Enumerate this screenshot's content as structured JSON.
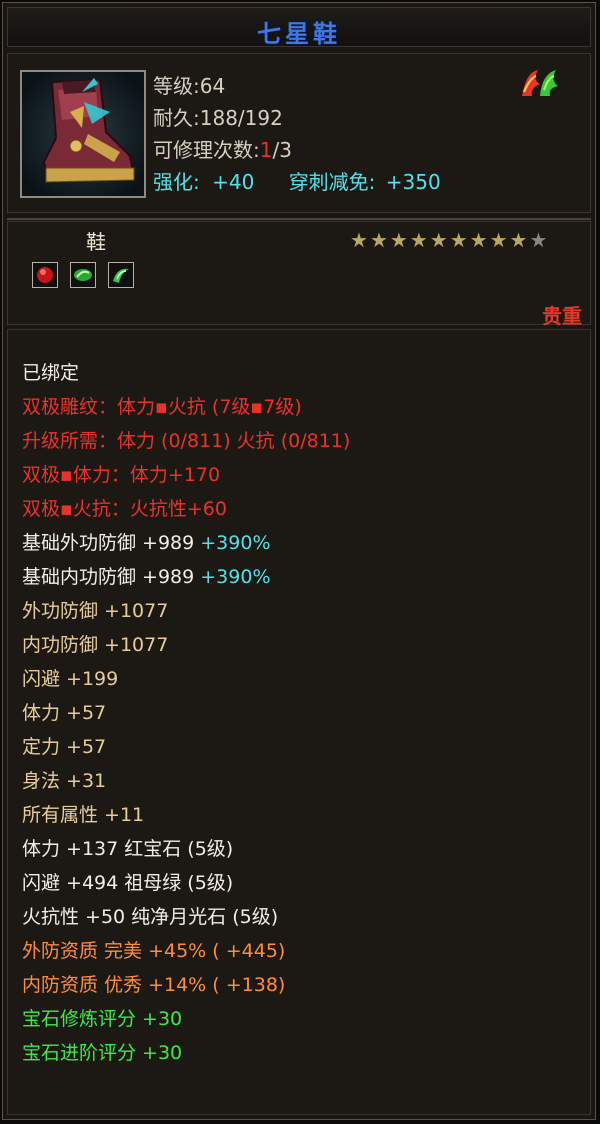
{
  "item": {
    "name": "七星鞋",
    "level_label": "等级:",
    "level": "64",
    "durability_label": "耐久:",
    "durability": "188/192",
    "repair_label": "可修理次数:",
    "repair_used": "1",
    "repair_total": "/3",
    "enhance_label": "强化:",
    "enhance_value": "+40",
    "pierce_label": "穿刺减免:",
    "pierce_value": "+350",
    "type": "鞋",
    "stars_filled": 9,
    "stars_total": 10,
    "rarity": "贵重",
    "icon": "boot-icon",
    "gem_icons": [
      "ruby-gem-icon",
      "emerald-gem-icon",
      "moonstone-gem-icon"
    ],
    "badge_icon": "dragon-badge-icon"
  },
  "stats": {
    "bound": "已绑定",
    "dual_pattern": "双极雕纹：体力▪火抗 (7级▪7级)",
    "upgrade_need": "升级所需：体力 (0/811)   火抗 (0/811)",
    "dual_vit": "双极▪体力：体力+170",
    "dual_fire": "双极▪火抗：火抗性+60",
    "base_ext_def": "基础外功防御 +989 ",
    "base_ext_def_pct": "+390%",
    "base_int_def": "基础内功防御 +989 ",
    "base_int_def_pct": "+390%",
    "ext_def": "外功防御 +1077",
    "int_def": "内功防御 +1077",
    "dodge": "闪避 +199",
    "vit": "体力 +57",
    "focus": "定力 +57",
    "agility": "身法 +31",
    "all_attr": "所有属性 +11",
    "gem_vit": "体力 +137 红宝石 (5级)",
    "gem_dodge": "闪避 +494 祖母绿 (5级)",
    "gem_fire": "火抗性 +50 纯净月光石 (5级)",
    "ext_quality": "外防资质  完美 +45% ( +445)",
    "int_quality": "内防资质  优秀 +14% ( +138)",
    "gem_refine": "宝石修炼评分 +30",
    "gem_advance": "宝石进阶评分 +30"
  }
}
